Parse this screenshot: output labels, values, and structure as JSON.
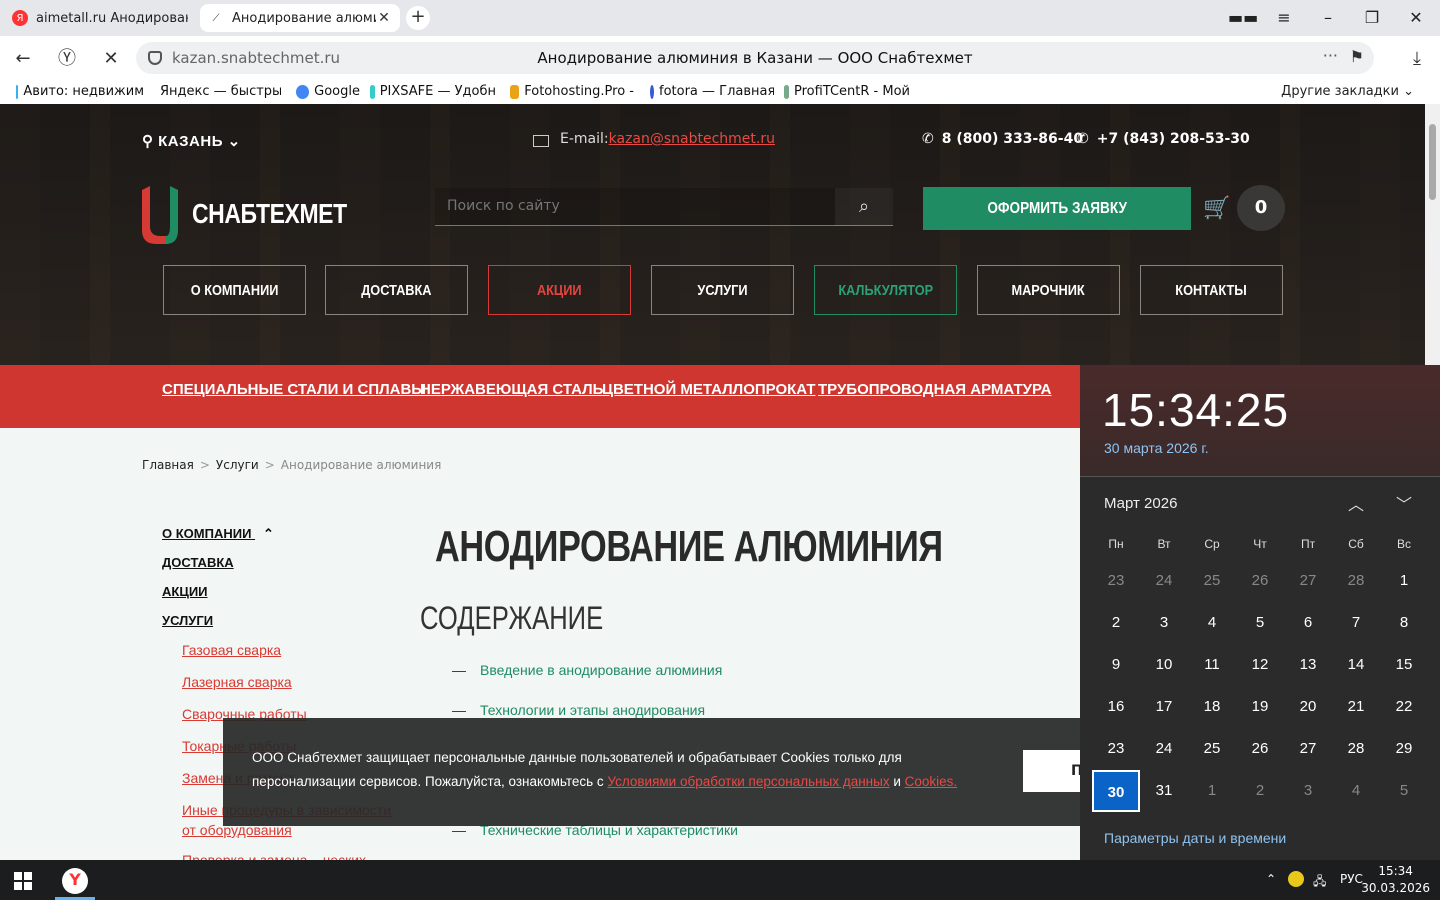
{
  "browser": {
    "tabs": [
      {
        "title": "aimetall.ru Анодирование"
      },
      {
        "title": "Анодирование алюминия"
      }
    ],
    "url_domain": "kazan.snabtechmet.ru",
    "page_title": "Анодирование алюминия в Казани — ООО Снабтехмет",
    "bookmarks": [
      "Авито: недвижим",
      "Яндекс — быстры",
      "Google",
      "PIXSAFE — Удобн",
      "Fotohosting.Pro -",
      "fotora — Главная",
      "ProfiTCentR - Мой"
    ],
    "other_bookmarks": "Другие закладки"
  },
  "header": {
    "city": "КАЗАНЬ",
    "email_label": "E-mail:",
    "email": "kazan@snabtechmet.ru",
    "phone1": "8 (800) 333-86-40",
    "phone2": "+7 (843) 208-53-30",
    "logo": "СНАБТЕХМЕТ",
    "search_placeholder": "Поиск по сайту",
    "order_button": "ОФОРМИТЬ ЗАЯВКУ",
    "cart_count": "0",
    "menu": [
      "О КОМПАНИИ",
      "ДОСТАВКА",
      "АКЦИИ",
      "УСЛУГИ",
      "КАЛЬКУЛЯТОР",
      "МАРОЧНИК",
      "КОНТАКТЫ"
    ],
    "categories": [
      "СПЕЦИАЛЬНЫЕ СТАЛИ И СПЛАВЫ",
      "НЕРЖАВЕЮЩАЯ СТАЛЬ",
      "ЦВЕТНОЙ МЕТАЛЛОПРОКАТ",
      "ТРУБОПРОВОДНАЯ АРМАТУРА"
    ]
  },
  "breadcrumb": {
    "home": "Главная",
    "sep": ">",
    "section": "Услуги",
    "current": "Анодирование алюминия"
  },
  "sidebar": {
    "main": [
      "О КОМПАНИИ",
      "ДОСТАВКА",
      "АКЦИИ",
      "УСЛУГИ"
    ],
    "sub": [
      "Газовая сварка",
      "Лазерная сварка",
      "Сварочные работы",
      "Токарные работы",
      "Замена и ремонт",
      "Иные процедуры в зависимости",
      "от оборудования",
      "Проверка и замена ...ческих"
    ]
  },
  "content": {
    "title": "АНОДИРОВАНИЕ АЛЮМИНИЯ",
    "toc_title": "СОДЕРЖАНИЕ",
    "toc_dash": "—",
    "toc": [
      "Введение в анодирование алюминия",
      "Технологии и этапы анодирования",
      "Технические таблицы и характеристики"
    ]
  },
  "cookie": {
    "text_before": "ООО Снабтехмет защищает персональные данные пользователей и обрабатывает Cookies только для персонализации сервисов. Пожалуйста, ознакомьтесь с ",
    "link1": "Условиями обработки персональных данных",
    "and": " и ",
    "link2": "Cookies.",
    "button": "П"
  },
  "calendar": {
    "time": "15:34:25",
    "date": "30 марта 2026 г.",
    "month": "Март 2026",
    "weekdays": [
      "Пн",
      "Вт",
      "Ср",
      "Чт",
      "Пт",
      "Сб",
      "Вс"
    ],
    "days": [
      "23",
      "24",
      "25",
      "26",
      "27",
      "28",
      "1",
      "2",
      "3",
      "4",
      "5",
      "6",
      "7",
      "8",
      "9",
      "10",
      "11",
      "12",
      "13",
      "14",
      "15",
      "16",
      "17",
      "18",
      "19",
      "20",
      "21",
      "22",
      "23",
      "24",
      "25",
      "26",
      "27",
      "28",
      "29",
      "30",
      "31",
      "1",
      "2",
      "3",
      "4",
      "5"
    ],
    "dim_indices": [
      0,
      1,
      2,
      3,
      4,
      5,
      37,
      38,
      39,
      40,
      41
    ],
    "today_index": 35,
    "settings_link": "Параметры даты и времени"
  },
  "taskbar": {
    "lang": "РУС",
    "time": "15:34",
    "date": "30.03.2026"
  },
  "colors": {
    "brand_green": "#1f8c63",
    "brand_red": "#cf3630",
    "calendar_today": "#0a64c8"
  }
}
